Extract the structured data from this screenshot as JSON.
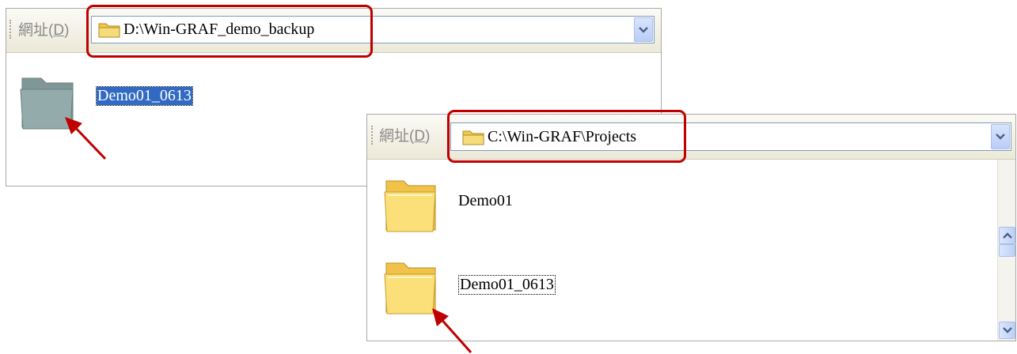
{
  "window_backup": {
    "address_label": "網址",
    "address_accesskey": "D",
    "address_path": "D:\\Win-GRAF_demo_backup",
    "items": [
      {
        "name": "Demo01_0613",
        "state": "selected"
      }
    ]
  },
  "window_projects": {
    "address_label": "網址",
    "address_accesskey": "D",
    "address_path": "C:\\Win-GRAF\\Projects",
    "items": [
      {
        "name": "Demo01",
        "state": "normal"
      },
      {
        "name": "Demo01_0613",
        "state": "focused"
      }
    ]
  },
  "colors": {
    "highlight_border": "#c00000",
    "annotation_arrow": "#c00000",
    "selection": "#316ac5",
    "folder_yellow": "#f2c94c",
    "folder_ghost": "#8fa7a6"
  },
  "icons": [
    "folder-icon",
    "chevron-down-icon",
    "chevron-up-icon",
    "arrow-annotation-icon"
  ]
}
